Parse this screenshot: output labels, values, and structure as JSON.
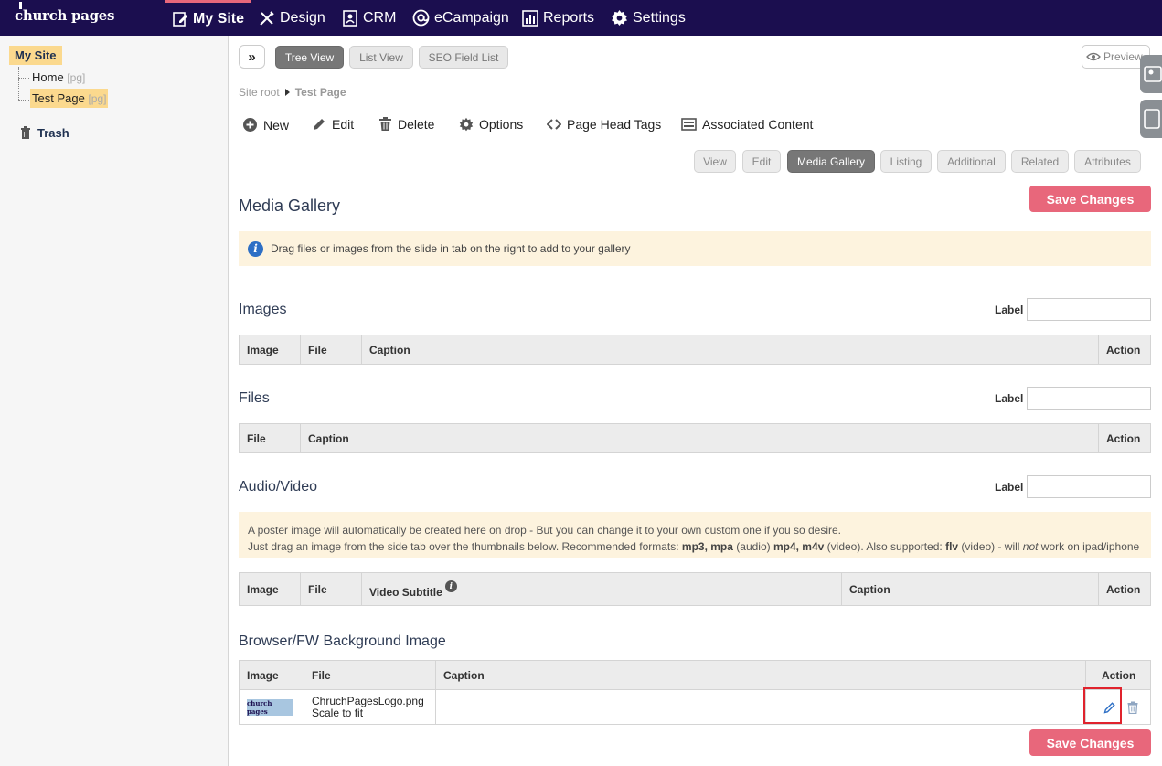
{
  "brand": {
    "logo_text": "church pages"
  },
  "nav": {
    "items": [
      {
        "label": "My Site",
        "icon": "edit-page-icon"
      },
      {
        "label": "Design",
        "icon": "design-tools-icon"
      },
      {
        "label": "CRM",
        "icon": "contacts-icon"
      },
      {
        "label": "eCampaign",
        "icon": "at-icon"
      },
      {
        "label": "Reports",
        "icon": "bar-chart-icon"
      },
      {
        "label": "Settings",
        "icon": "gear-icon"
      }
    ]
  },
  "sidebar": {
    "root": "My Site",
    "items": [
      {
        "label": "Home",
        "tag": "[pg]"
      },
      {
        "label": "Test Page",
        "tag": "[pg]"
      }
    ],
    "trash": "Trash"
  },
  "toolbar": {
    "expand": "»",
    "views": [
      "Tree View",
      "List View",
      "SEO Field List"
    ],
    "preview": "Preview"
  },
  "breadcrumb": {
    "root": "Site root",
    "current": "Test Page"
  },
  "actions": [
    "New",
    "Edit",
    "Delete",
    "Options",
    "Page Head Tags",
    "Associated Content"
  ],
  "tabs": [
    "View",
    "Edit",
    "Media Gallery",
    "Listing",
    "Additional",
    "Related",
    "Attributes"
  ],
  "page": {
    "title": "Media Gallery",
    "save_label": "Save Changes",
    "info": "Drag files or images from the slide in tab on the right to add to your gallery",
    "label_text": "Label"
  },
  "images": {
    "title": "Images",
    "columns": [
      "Image",
      "File",
      "Caption",
      "Action"
    ]
  },
  "files": {
    "title": "Files",
    "columns": [
      "File",
      "Caption",
      "Action"
    ]
  },
  "audio_video": {
    "title": "Audio/Video",
    "note_line1": "A poster image will automatically be created here on drop - But you can change it to your own custom one if you so desire.",
    "note_line2_a": "Just drag an image from the side tab over the thumbnails below. Recommended formats: ",
    "note_mp3": "mp3, mpa",
    "note_audio": " (audio) ",
    "note_mp4": "mp4, m4v",
    "note_video": " (video). Also supported: ",
    "note_flv": "flv",
    "note_will": " (video) - will ",
    "note_not": "not",
    "note_end": " work on ipad/iphone",
    "columns": [
      "Image",
      "File",
      "Video Subtitle",
      "Caption",
      "Action"
    ]
  },
  "background": {
    "title": "Browser/FW Background Image",
    "columns": [
      "Image",
      "File",
      "Caption",
      "Action"
    ],
    "row": {
      "thumb_text": "church pages",
      "file_name": "ChruchPagesLogo.png",
      "mode": "Scale to fit",
      "caption": ""
    }
  }
}
